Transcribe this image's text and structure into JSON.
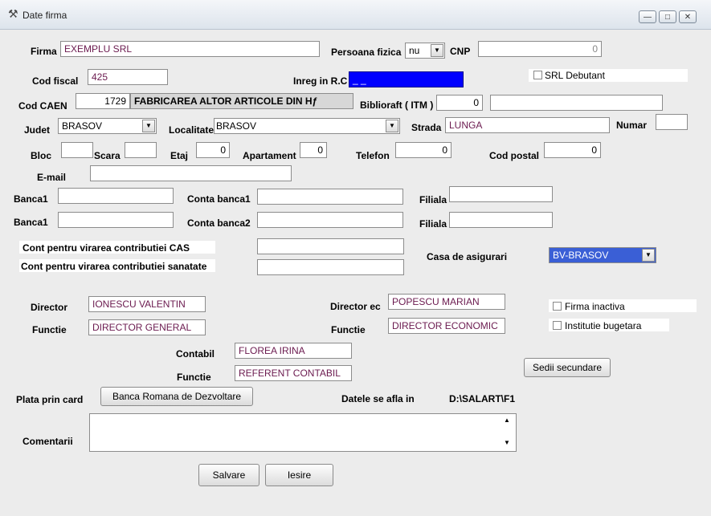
{
  "window": {
    "title": "Date firma",
    "minimize": "—",
    "maximize": "□",
    "close": "✕"
  },
  "firma": {
    "label": "Firma",
    "value": "EXEMPLU SRL"
  },
  "persoana_fizica": {
    "label": "Persoana fizica",
    "value": "nu"
  },
  "cnp": {
    "label": "CNP",
    "value": "0"
  },
  "cod_fiscal": {
    "label": "Cod fiscal",
    "value": "425"
  },
  "inreg_rc": {
    "label": "Inreg in R.C",
    "value": "_ _"
  },
  "srl_debutant": {
    "label": "SRL Debutant"
  },
  "cod_caen": {
    "label": "Cod CAEN",
    "value": "1729",
    "description": "FABRICAREA ALTOR ARTICOLE DIN Hƒ"
  },
  "biblioraft": {
    "label": "Biblioraft ( ITM )",
    "value": "0",
    "extra": ""
  },
  "judet": {
    "label": "Judet",
    "value": "BRASOV"
  },
  "localitate": {
    "label": "Localitate",
    "value": "BRASOV"
  },
  "strada": {
    "label": "Strada",
    "value": "LUNGA"
  },
  "numar": {
    "label": "Numar",
    "value": ""
  },
  "bloc": {
    "label": "Bloc",
    "value": ""
  },
  "scara": {
    "label": "Scara",
    "value": ""
  },
  "etaj": {
    "label": "Etaj",
    "value": "0"
  },
  "apartament": {
    "label": "Apartament",
    "value": "0"
  },
  "telefon": {
    "label": "Telefon",
    "value": "0"
  },
  "cod_postal": {
    "label": "Cod postal",
    "value": "0"
  },
  "email": {
    "label": "E-mail",
    "value": ""
  },
  "banca1_row1": {
    "label": "Banca1",
    "value": "",
    "conta_label": "Conta banca1",
    "conta_value": "",
    "filiala_label": "Filiala",
    "filiala_value": ""
  },
  "banca1_row2": {
    "label": "Banca1",
    "value": "",
    "conta_label": "Conta banca2",
    "conta_value": "",
    "filiala_label": "Filiala",
    "filiala_value": ""
  },
  "cont_cas": {
    "label": "Cont pentru virarea contributiei CAS",
    "value": ""
  },
  "cont_sanatate": {
    "label": "Cont pentru virarea contributiei sanatate",
    "value": ""
  },
  "casa_asigurari": {
    "label": "Casa de asigurari",
    "value": "BV-BRASOV"
  },
  "director": {
    "label": "Director",
    "value": "IONESCU VALENTIN"
  },
  "director_functie": {
    "label": "Functie",
    "value": "DIRECTOR GENERAL"
  },
  "director_ec": {
    "label": "Director ec",
    "value": "POPESCU MARIAN"
  },
  "director_ec_functie": {
    "label": "Functie",
    "value": "DIRECTOR ECONOMIC"
  },
  "firma_inactiva": {
    "label": "Firma inactiva"
  },
  "institutie_bugetara": {
    "label": "Institutie bugetara"
  },
  "contabil": {
    "label": "Contabil",
    "value": "FLOREA IRINA"
  },
  "contabil_functie": {
    "label": "Functie",
    "value": "REFERENT CONTABIL"
  },
  "sedii_secundare": {
    "label": "Sedii secundare"
  },
  "plata_card": {
    "label": "Plata prin card",
    "bank_button": "Banca Romana de Dezvoltare"
  },
  "date_location": {
    "label": "Datele se afla in",
    "value": "D:\\SALART\\F1"
  },
  "comentarii": {
    "label": "Comentarii",
    "value": ""
  },
  "buttons": {
    "save": "Salvare",
    "exit": "Iesire"
  },
  "colors": {
    "inreg_bg": "#0000ff",
    "casa_bg": "#3a5fd6",
    "value_text": "#6b1a4f"
  }
}
